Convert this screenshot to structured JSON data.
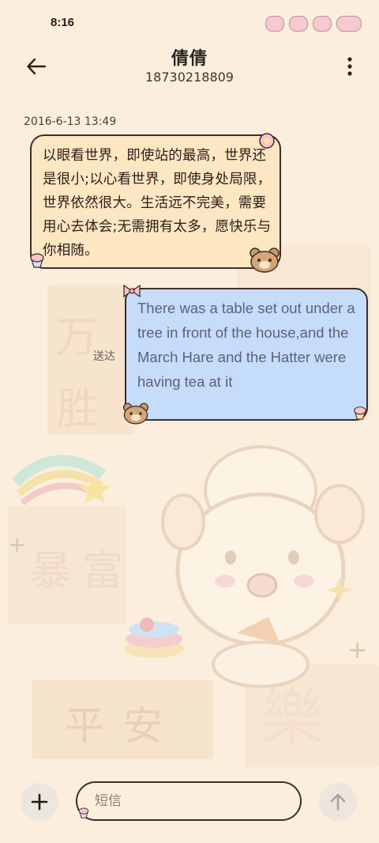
{
  "status_bar": {
    "time": "8:16"
  },
  "header": {
    "contact_name": "倩倩",
    "phone_number": "18730218809",
    "back_icon": "arrow-left-icon",
    "more_icon": "more-vertical-icon"
  },
  "conversation": {
    "timestamp": "2016-6-13 13:49",
    "messages": [
      {
        "direction": "incoming",
        "text": "以眼看世界，即使站的最高，世界还是很小;以心看世界，即使身处局限，世界依然很大。生活远不完美，需要用心去体会;无需拥有太多，愿快乐与你相随。"
      },
      {
        "direction": "outgoing",
        "text": "There was a table set out under a tree in front of the house,and the March Hare and the Hatter were having tea at it",
        "status": "送达"
      }
    ]
  },
  "composer": {
    "placeholder": "短信",
    "add_icon": "plus-icon",
    "send_icon": "arrow-up-icon"
  },
  "colors": {
    "background": "#fbeedd",
    "incoming_bubble": "#fde6c2",
    "outgoing_bubble": "#c6dcfb",
    "outline": "#3e2f26"
  }
}
